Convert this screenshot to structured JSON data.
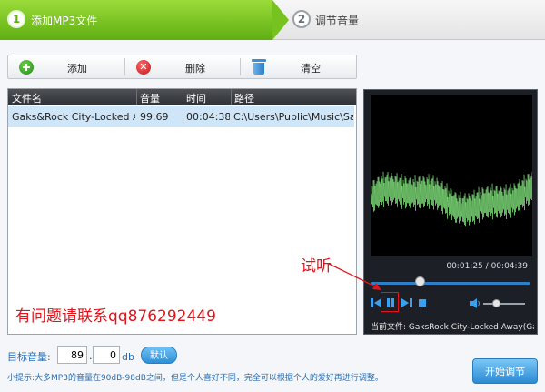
{
  "steps": {
    "step1": {
      "number": "1",
      "label": "添加MP3文件"
    },
    "step2": {
      "number": "2",
      "label": "调节音量"
    }
  },
  "toolbar": {
    "add_label": "添加",
    "delete_label": "删除",
    "clear_label": "清空",
    "icons": {
      "add": "add-icon",
      "delete": "delete-icon",
      "clear": "trash-icon"
    }
  },
  "table": {
    "headers": [
      "文件名",
      "音量",
      "时间",
      "路径"
    ],
    "rows": [
      {
        "name": "Gaks&Rock City-Locked A...",
        "volume": "99.69",
        "time": "00:04:38",
        "path": "C:\\Users\\Public\\Music\\Sa..."
      }
    ]
  },
  "player": {
    "elapsed": "00:01:25",
    "separator": "/",
    "total": "00:04:39",
    "progress": 0.31,
    "volume_level": 0.3,
    "now_playing_label": "当前文件:",
    "now_playing_name": "GaksRock City-Locked Away(Gaks Rem"
  },
  "annotations": {
    "try_listen": "试听",
    "contact": "有问题请联系qq876292449"
  },
  "bottom": {
    "target_label": "目标音量:",
    "volume_int": "89",
    "volume_dot": ".",
    "volume_dec": "0",
    "unit": "db",
    "default_button": "默认",
    "tip": "小提示:大多MP3的音量在90dB-98dB之间，但是个人喜好不同，完全可以根据个人的爱好再进行调整。",
    "start_button": "开始调节"
  },
  "colors": {
    "step_active": "#6cbc1a",
    "annotation": "#e0141a",
    "accent_blue": "#2d8fd6",
    "waveform": "#7fe07a"
  }
}
